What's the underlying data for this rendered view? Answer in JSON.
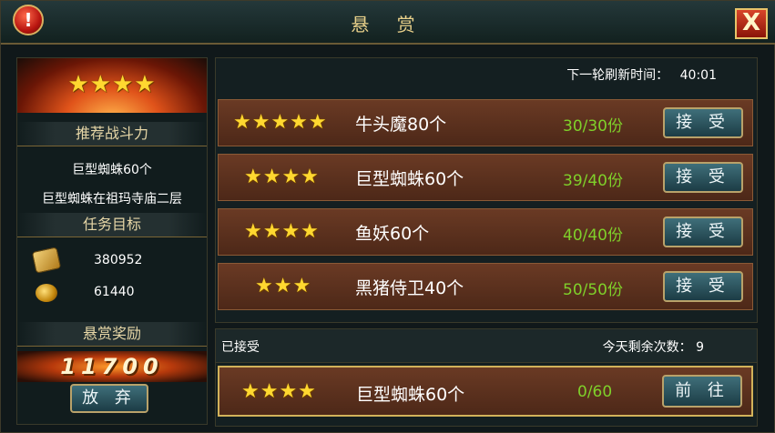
{
  "window": {
    "title": "悬 赏",
    "info_symbol": "!",
    "close_symbol": "X"
  },
  "left_panel": {
    "stars": "★★★★",
    "recommended_power_title": "推荐战斗力",
    "target_name": "巨型蜘蛛60个",
    "target_location": "巨型蜘蛛在祖玛寺庙二层",
    "mission_goal_title": "任务目标",
    "rewards": [
      {
        "icon": "scroll-icon",
        "value": "380952"
      },
      {
        "icon": "gold-coin-icon",
        "value": "61440"
      }
    ],
    "bounty_reward_title": "悬赏奖励",
    "bounty_value": "11700",
    "abandon_label": "放 弃"
  },
  "refresh": {
    "label": "下一轮刷新时间：",
    "time": "40:01"
  },
  "bounties": [
    {
      "stars": "★★★★★",
      "name": "牛头魔80个",
      "count": "30/30份",
      "button": "接 受"
    },
    {
      "stars": "★★★★",
      "name": "巨型蜘蛛60个",
      "count": "39/40份",
      "button": "接 受"
    },
    {
      "stars": "★★★★",
      "name": "鱼妖60个",
      "count": "40/40份",
      "button": "接 受"
    },
    {
      "stars": "★★★",
      "name": "黑猪侍卫40个",
      "count": "50/50份",
      "button": "接 受"
    }
  ],
  "accepted_section": {
    "label": "已接受",
    "remaining_label": "今天剩余次数：",
    "remaining_value": "9",
    "task": {
      "stars": "★★★★",
      "name": "巨型蜘蛛60个",
      "progress": "0/60",
      "button": "前 往"
    }
  },
  "colors": {
    "gold": "#ffd830",
    "progress_green": "#7fd02a",
    "row_brown": "#5a3220",
    "button_teal": "#2d5560"
  }
}
